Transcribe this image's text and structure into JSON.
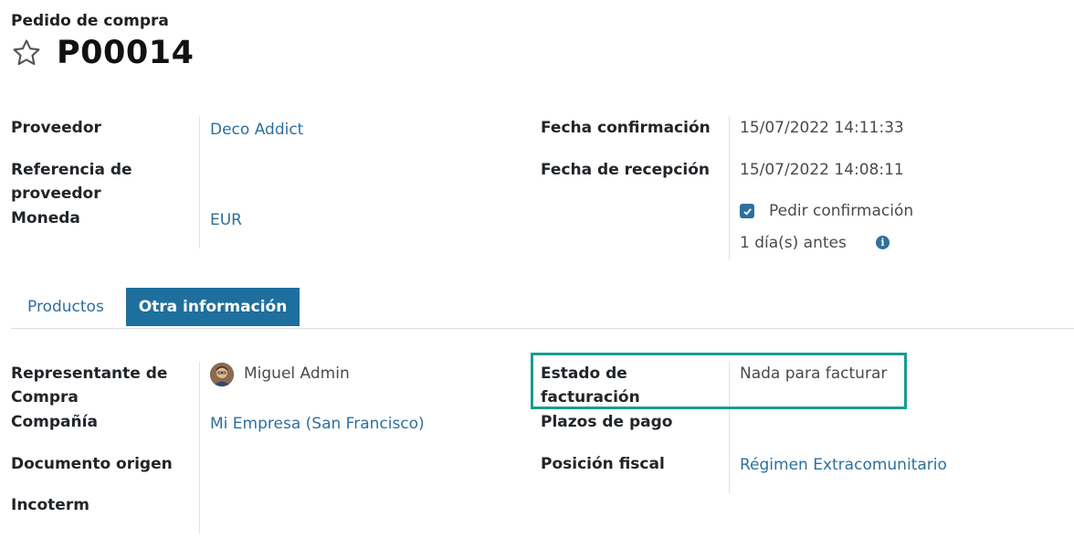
{
  "header": {
    "breadcrumb": "Pedido de compra",
    "record_name": "P00014"
  },
  "fields": {
    "proveedor_label": "Proveedor",
    "proveedor_value": "Deco Addict",
    "ref_proveedor_label": "Referencia de proveedor",
    "moneda_label": "Moneda",
    "moneda_value": "EUR",
    "fecha_confirmacion_label": "Fecha confirmación",
    "fecha_confirmacion_value": "15/07/2022 14:11:33",
    "fecha_recepcion_label": "Fecha de recepción",
    "fecha_recepcion_value": "15/07/2022 14:08:11",
    "pedir_confirmacion_label": "Pedir confirmación",
    "dias_antes": "1 día(s) antes"
  },
  "tabs": [
    {
      "label": "Productos",
      "active": false
    },
    {
      "label": "Otra información",
      "active": true
    }
  ],
  "other_info": {
    "representante_label": "Representante de Compra",
    "representante_value": "Miguel Admin",
    "compania_label": "Compañía",
    "compania_value": "Mi Empresa (San Francisco)",
    "documento_origen_label": "Documento origen",
    "incoterm_label": "Incoterm",
    "estado_facturacion_label": "Estado de facturación",
    "estado_facturacion_value": "Nada para facturar",
    "plazos_pago_label": "Plazos de pago",
    "posicion_fiscal_label": "Posición fiscal",
    "posicion_fiscal_value": "Régimen Extracomunitario"
  },
  "colors": {
    "link": "#2e6f9e",
    "tab_active_bg": "#1f6f9e",
    "highlight": "#1a9c91"
  },
  "icons": {
    "star": "star-outline-icon",
    "checkbox": "checkbox-checked-icon",
    "info": "info-icon"
  }
}
